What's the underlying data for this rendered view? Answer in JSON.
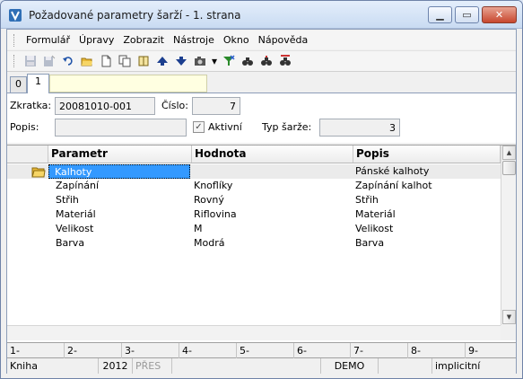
{
  "window": {
    "title": "Požadované parametry šarží - 1. strana"
  },
  "menu": {
    "items": [
      "Formulář",
      "Úpravy",
      "Zobrazit",
      "Nástroje",
      "Okno",
      "Nápověda"
    ]
  },
  "toolbar": {
    "icons": [
      "save-icon",
      "save-as-icon",
      "undo-icon",
      "open-folder-icon",
      "new-document-icon",
      "copy-icon",
      "book-icon",
      "arrow-up-icon",
      "arrow-down-icon",
      "camera-icon",
      "dropdown-icon",
      "filter-icon",
      "find-icon",
      "find-next-icon",
      "find-all-icon"
    ]
  },
  "tabs": [
    {
      "label": "0"
    },
    {
      "label": "1"
    }
  ],
  "form": {
    "zkratka_label": "Zkratka:",
    "zkratka_value": "20081010-001",
    "cislo_label": "Číslo:",
    "cislo_value": "7",
    "popis_label": "Popis:",
    "popis_value": "",
    "aktivni_label": "Aktivní",
    "aktivni_checked": true,
    "aktivni_mark": "✓",
    "typ_label": "Typ šarže:",
    "typ_value": "3"
  },
  "grid": {
    "columns": [
      "Parametr",
      "Hodnota",
      "Popis"
    ],
    "rows": [
      {
        "parametr": "Kalhoty",
        "hodnota": "",
        "popis": "Pánské kalhoty",
        "selected": true,
        "folder": true
      },
      {
        "parametr": "Zapínání",
        "hodnota": "Knoflíky",
        "popis": "Zapínání kalhot"
      },
      {
        "parametr": "Střih",
        "hodnota": "Rovný",
        "popis": "Střih"
      },
      {
        "parametr": "Materiál",
        "hodnota": "Riflovina",
        "popis": "Materiál"
      },
      {
        "parametr": "Velikost",
        "hodnota": "M",
        "popis": "Velikost"
      },
      {
        "parametr": "Barva",
        "hodnota": "Modrá",
        "popis": "Barva"
      }
    ]
  },
  "fkeys": [
    "1-",
    "2-",
    "3-",
    "4-",
    "5-",
    "6-",
    "7-",
    "8-",
    "9-"
  ],
  "status": {
    "module": "Kniha",
    "year": "2012",
    "pres": "PŘES",
    "db": "DEMO",
    "mode": "implicitní"
  },
  "colors": {
    "selection": "#3399ff",
    "accent": "#1f5fbf"
  }
}
